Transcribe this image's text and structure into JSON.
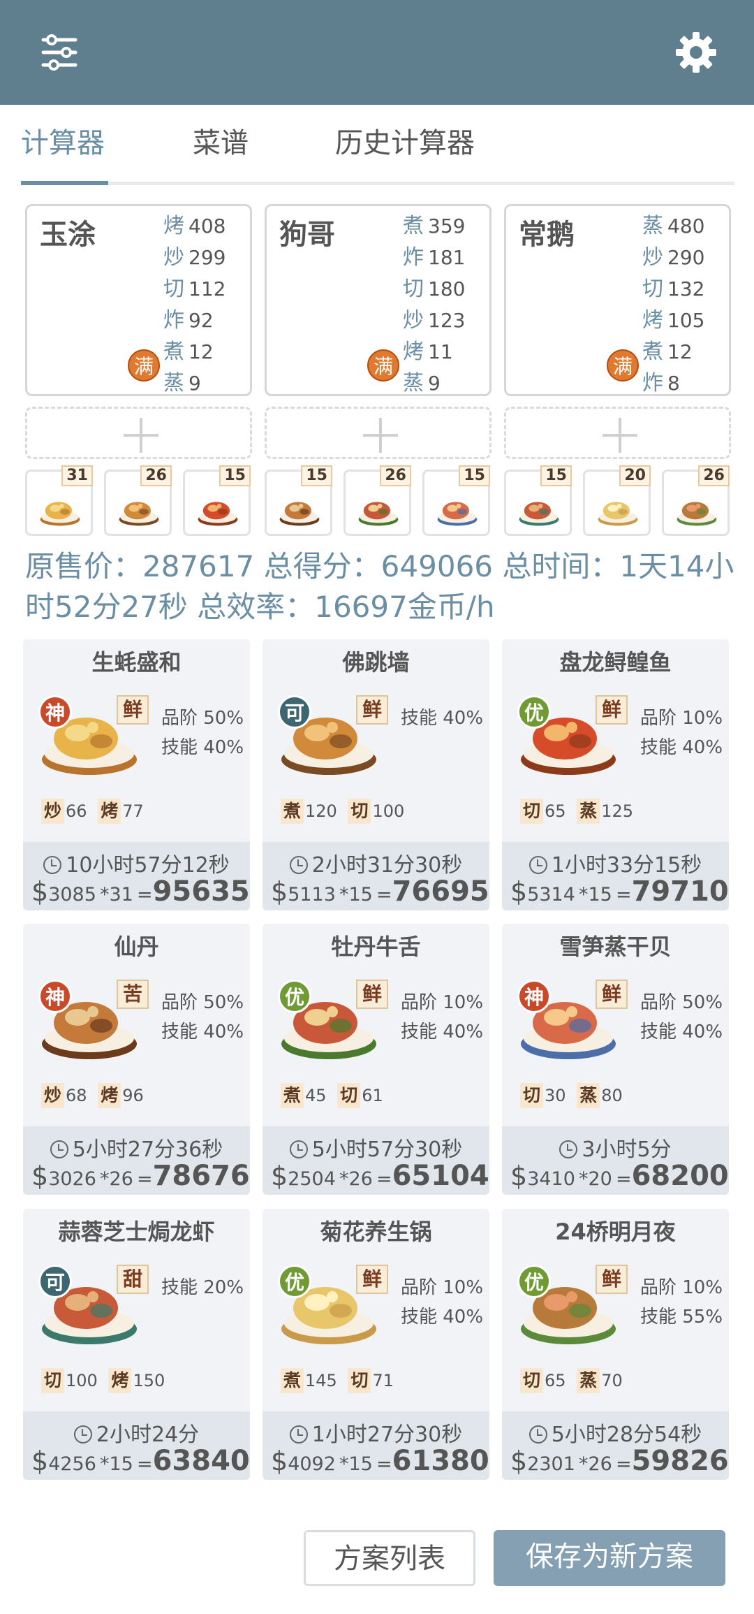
{
  "header": {
    "menu_icon": "sliders-icon",
    "settings_icon": "gear-icon"
  },
  "tabs": [
    {
      "label": "计算器"
    },
    {
      "label": "菜谱"
    },
    {
      "label": "历史计算器"
    }
  ],
  "chefs": [
    {
      "name": "玉涂",
      "badge": "满",
      "stats": [
        {
          "k": "烤",
          "v": "408"
        },
        {
          "k": "炒",
          "v": "299"
        },
        {
          "k": "切",
          "v": "112"
        },
        {
          "k": "炸",
          "v": "92"
        },
        {
          "k": "煮",
          "v": "12"
        },
        {
          "k": "蒸",
          "v": "9"
        }
      ]
    },
    {
      "name": "狗哥",
      "badge": "满",
      "stats": [
        {
          "k": "煮",
          "v": "359"
        },
        {
          "k": "炸",
          "v": "181"
        },
        {
          "k": "切",
          "v": "180"
        },
        {
          "k": "炒",
          "v": "123"
        },
        {
          "k": "烤",
          "v": "11"
        },
        {
          "k": "蒸",
          "v": "9"
        }
      ]
    },
    {
      "name": "常鹅",
      "badge": "满",
      "stats": [
        {
          "k": "蒸",
          "v": "480"
        },
        {
          "k": "炒",
          "v": "290"
        },
        {
          "k": "切",
          "v": "132"
        },
        {
          "k": "烤",
          "v": "105"
        },
        {
          "k": "煮",
          "v": "12"
        },
        {
          "k": "炸",
          "v": "8"
        }
      ]
    }
  ],
  "thumb_counts": [
    "31",
    "26",
    "15",
    "15",
    "26",
    "15",
    "15",
    "20",
    "26"
  ],
  "summary": "原售价：287617 总得分：649066 总时间：1天14小时52分27秒 总效率：16697金币/h",
  "recipes": [
    {
      "name": "生蚝盛和",
      "rank": "神",
      "rank_color": "#c84a2a",
      "flavor": "鲜",
      "bonus1": "品阶 50%",
      "bonus2": "技能 40%",
      "s1k": "炒",
      "s1v": "66",
      "s2k": "烤",
      "s2v": "77",
      "time": "10小时57分12秒",
      "unit": "3085",
      "mult": "*31",
      "eq": "=",
      "total": "95635"
    },
    {
      "name": "佛跳墙",
      "rank": "可",
      "rank_color": "#3d6670",
      "flavor": "鲜",
      "bonus1": "技能 40%",
      "bonus2": "",
      "s1k": "煮",
      "s1v": "120",
      "s2k": "切",
      "s2v": "100",
      "time": "2小时31分30秒",
      "unit": "5113",
      "mult": "*15",
      "eq": "=",
      "total": "76695"
    },
    {
      "name": "盘龙鲟鳇鱼",
      "rank": "优",
      "rank_color": "#6f9a34",
      "flavor": "鲜",
      "bonus1": "品阶 10%",
      "bonus2": "技能 40%",
      "s1k": "切",
      "s1v": "65",
      "s2k": "蒸",
      "s2v": "125",
      "time": "1小时33分15秒",
      "unit": "5314",
      "mult": "*15",
      "eq": "=",
      "total": "79710"
    },
    {
      "name": "仙丹",
      "rank": "神",
      "rank_color": "#c84a2a",
      "flavor": "苦",
      "bonus1": "品阶 50%",
      "bonus2": "技能 40%",
      "s1k": "炒",
      "s1v": "68",
      "s2k": "烤",
      "s2v": "96",
      "time": "5小时27分36秒",
      "unit": "3026",
      "mult": "*26",
      "eq": "=",
      "total": "78676"
    },
    {
      "name": "牡丹牛舌",
      "rank": "优",
      "rank_color": "#6f9a34",
      "flavor": "鲜",
      "bonus1": "品阶 10%",
      "bonus2": "技能 40%",
      "s1k": "煮",
      "s1v": "45",
      "s2k": "切",
      "s2v": "61",
      "time": "5小时57分30秒",
      "unit": "2504",
      "mult": "*26",
      "eq": "=",
      "total": "65104"
    },
    {
      "name": "雪笋蒸干贝",
      "rank": "神",
      "rank_color": "#c84a2a",
      "flavor": "鲜",
      "bonus1": "品阶 50%",
      "bonus2": "技能 40%",
      "s1k": "切",
      "s1v": "30",
      "s2k": "蒸",
      "s2v": "80",
      "time": "3小时5分",
      "unit": "3410",
      "mult": "*20",
      "eq": "=",
      "total": "68200"
    },
    {
      "name": "蒜蓉芝士焗龙虾",
      "rank": "可",
      "rank_color": "#3d6670",
      "flavor": "甜",
      "bonus1": "技能 20%",
      "bonus2": "",
      "s1k": "切",
      "s1v": "100",
      "s2k": "烤",
      "s2v": "150",
      "time": "2小时24分",
      "unit": "4256",
      "mult": "*15",
      "eq": "=",
      "total": "63840"
    },
    {
      "name": "菊花养生锅",
      "rank": "优",
      "rank_color": "#6f9a34",
      "flavor": "鲜",
      "bonus1": "品阶 10%",
      "bonus2": "技能 40%",
      "s1k": "煮",
      "s1v": "145",
      "s2k": "切",
      "s2v": "71",
      "time": "1小时27分30秒",
      "unit": "4092",
      "mult": "*15",
      "eq": "=",
      "total": "61380"
    },
    {
      "name": "24桥明月夜",
      "rank": "优",
      "rank_color": "#6f9a34",
      "flavor": "鲜",
      "bonus1": "品阶 10%",
      "bonus2": "技能 55%",
      "s1k": "切",
      "s1v": "65",
      "s2k": "蒸",
      "s2v": "70",
      "time": "5小时28分54秒",
      "unit": "2301",
      "mult": "*26",
      "eq": "=",
      "total": "59826"
    }
  ],
  "currency_symbol": "$",
  "buttons": {
    "plan_list": "方案列表",
    "save_new": "保存为新方案"
  }
}
